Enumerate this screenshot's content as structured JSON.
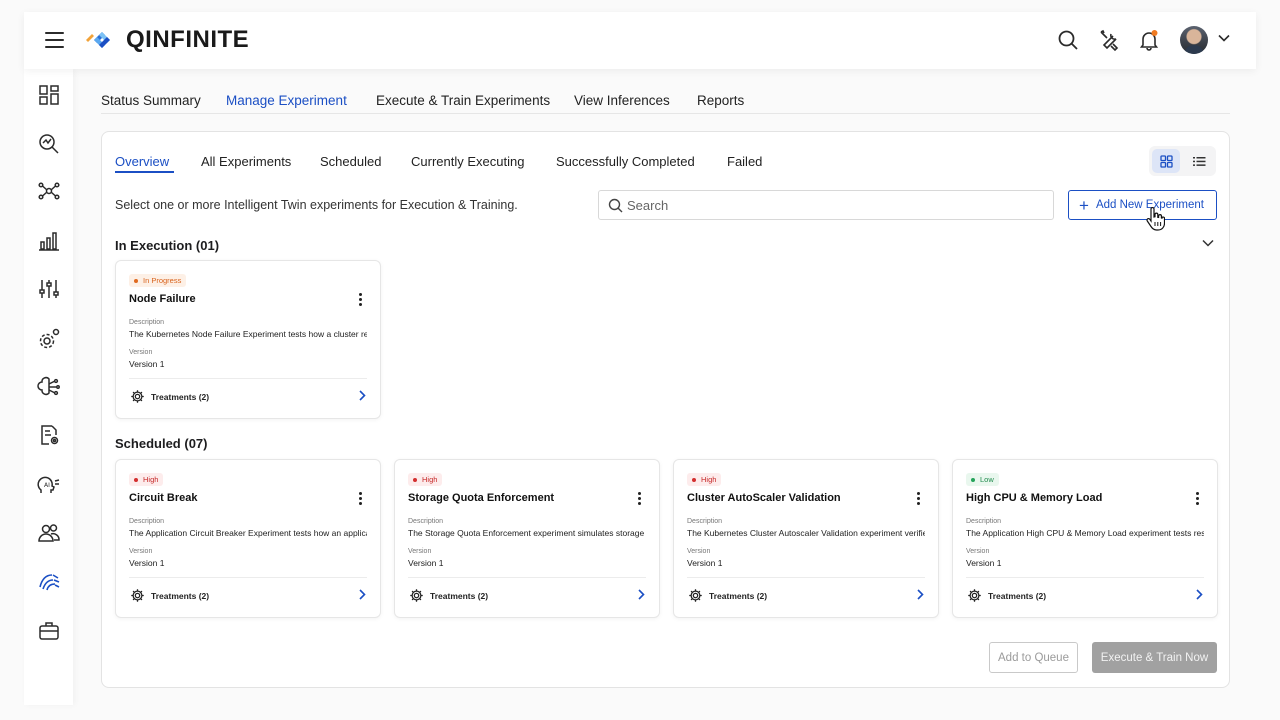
{
  "app": {
    "brand": "QINFINITE"
  },
  "header": {
    "icons": [
      "menu-icon",
      "search-icon",
      "tools-icon",
      "bell-icon",
      "avatar",
      "chevron-down-icon"
    ]
  },
  "sidebar": {
    "items": [
      "dashboard-icon",
      "analytics-search-icon",
      "network-icon",
      "bar-chart-icon",
      "sliders-icon",
      "settings-gear-icon",
      "brain-network-icon",
      "document-settings-icon",
      "ai-head-icon",
      "users-icon",
      "wave-fingerprint-icon",
      "briefcase-icon"
    ]
  },
  "main_tabs": {
    "items": [
      {
        "label": "Status Summary"
      },
      {
        "label": "Manage Experiment"
      },
      {
        "label": "Execute & Train Experiments"
      },
      {
        "label": "View Inferences"
      },
      {
        "label": "Reports"
      }
    ],
    "active": "Manage Experiment"
  },
  "sub_tabs": {
    "items": [
      {
        "label": "Overview"
      },
      {
        "label": "All Experiments"
      },
      {
        "label": "Scheduled"
      },
      {
        "label": "Currently Executing"
      },
      {
        "label": "Successfully Completed"
      },
      {
        "label": "Failed"
      }
    ],
    "active": "Overview"
  },
  "view_toggle": {
    "active": "grid-view"
  },
  "intro_text": "Select one or more Intelligent Twin experiments for Execution & Training.",
  "search": {
    "placeholder": "Search",
    "value": ""
  },
  "add_button": {
    "label": "Add New Experiment"
  },
  "in_execution": {
    "title": "In Execution",
    "count": "(01)",
    "cards": [
      {
        "status": "In Progress",
        "status_type": "progress",
        "title": "Node Failure",
        "description_label": "Description",
        "description": "The Kubernetes Node Failure Experiment tests how a cluster responds to node failures",
        "version_label": "Version",
        "version": "Version 1",
        "treatments": "Treatments (2)"
      }
    ]
  },
  "scheduled": {
    "title": "Scheduled",
    "count": "(07)",
    "cards": [
      {
        "status": "High",
        "status_type": "high",
        "title": "Circuit Break",
        "description_label": "Description",
        "description": "The Application Circuit Breaker Experiment tests how an application behaves",
        "version_label": "Version",
        "version": "Version 1",
        "treatments": "Treatments (2)"
      },
      {
        "status": "High",
        "status_type": "high",
        "title": "Storage Quota Enforcement",
        "description_label": "Description",
        "description": "The Storage Quota Enforcement experiment simulates storage limits",
        "version_label": "Version",
        "version": "Version 1",
        "treatments": "Treatments (2)"
      },
      {
        "status": "High",
        "status_type": "high",
        "title": "Cluster AutoScaler Validation",
        "description_label": "Description",
        "description": "The Kubernetes Cluster Autoscaler Validation experiment verifies scaling",
        "version_label": "Version",
        "version": "Version 1",
        "treatments": "Treatments (2)"
      },
      {
        "status": "Low",
        "status_type": "low",
        "title": "High CPU & Memory Load",
        "description_label": "Description",
        "description": "The Application High CPU & Memory Load experiment tests resource pressure",
        "version_label": "Version",
        "version": "Version 1",
        "treatments": "Treatments (2)"
      }
    ]
  },
  "footer_buttons": {
    "queue": "Add to Queue",
    "execute": "Execute & Train Now"
  },
  "colors": {
    "accent": "#1b4fc4",
    "high": "#d32f2f",
    "progress": "#e06a1f",
    "low": "#24a35a",
    "disabled": "#a1a1a1"
  }
}
